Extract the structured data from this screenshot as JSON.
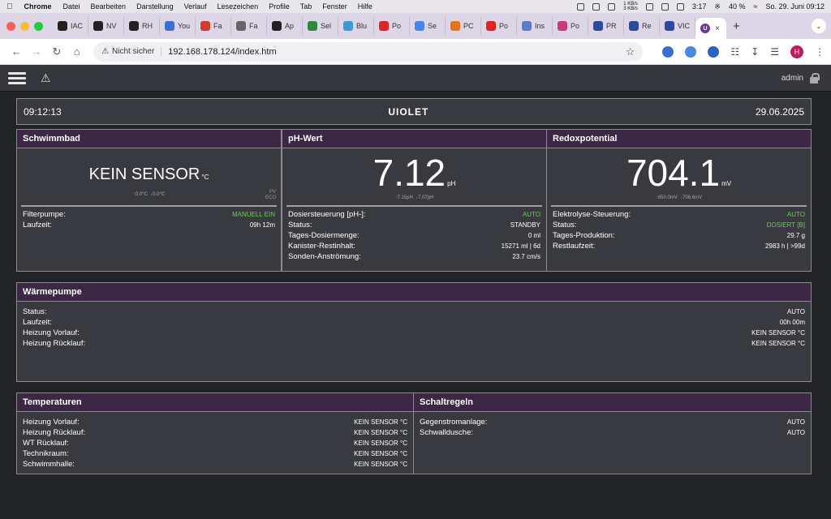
{
  "menubar": {
    "app": "Chrome",
    "items": [
      "Datei",
      "Bearbeiten",
      "Darstellung",
      "Verlauf",
      "Lesezeichen",
      "Profile",
      "Tab",
      "Fenster",
      "Hilfe"
    ],
    "net_up": "1 KB/s",
    "net_down": "3 KB/s",
    "time_small": "3:17",
    "battery": "40 %",
    "datetime": "So. 29. Juni  09:12"
  },
  "tabs": [
    {
      "label": "IAC",
      "color": "#222"
    },
    {
      "label": "NV",
      "color": "#222"
    },
    {
      "label": "RH",
      "color": "#222"
    },
    {
      "label": "You",
      "color": "#3b6fd6"
    },
    {
      "label": "Fa",
      "color": "#d23c2a"
    },
    {
      "label": "Fa",
      "color": "#666"
    },
    {
      "label": "Ap",
      "color": "#222"
    },
    {
      "label": "Sel",
      "color": "#2c8a3a"
    },
    {
      "label": "Blu",
      "color": "#3a9bd6"
    },
    {
      "label": "Po",
      "color": "#e02424"
    },
    {
      "label": "Se",
      "color": "#4285f4"
    },
    {
      "label": "PC",
      "color": "#e8721c"
    },
    {
      "label": "Po",
      "color": "#e02424"
    },
    {
      "label": "Ins",
      "color": "#5a7bc9"
    },
    {
      "label": "Po",
      "color": "#c93b7a"
    },
    {
      "label": "PR",
      "color": "#2b4aa0"
    },
    {
      "label": "Re",
      "color": "#2b4aa0"
    },
    {
      "label": "VIC",
      "color": "#2b4aa0"
    }
  ],
  "active_tab": {
    "close": "×"
  },
  "new_tab": "+",
  "tab_menu": "⌄",
  "address": {
    "security": "Nicht sicher",
    "url": "192.168.178.124/index.htm"
  },
  "profile_initial": "H",
  "app": {
    "user": "admin"
  },
  "clock": {
    "time": "09:12:13",
    "brand": "UIOLET",
    "date": "29.06.2025"
  },
  "pool": {
    "title": "Schwimmbad",
    "value": "KEIN SENSOR",
    "unit": "°C",
    "max": "0.0°C",
    "min": "0.0°C",
    "tag1": "PV",
    "tag2": "ECO",
    "rows": [
      {
        "label": "Filterpumpe:",
        "value": "MANUELL EIN",
        "green": true
      },
      {
        "label": "Laufzeit:",
        "value": "09h 12m",
        "green": false
      }
    ]
  },
  "ph": {
    "title": "pH-Wert",
    "value": "7.12",
    "unit": "pH",
    "max": "7.15pH",
    "min": "7.07pH",
    "rows": [
      {
        "label": "Dosiersteuerung [pH-]:",
        "value": "AUTO",
        "green": true
      },
      {
        "label": "Status:",
        "value": "STANDBY",
        "green": false
      },
      {
        "label": "Tages-Dosiermenge:",
        "value": "0 ml",
        "green": false
      },
      {
        "label": "Kanister-Restinhalt:",
        "value": "15271 ml | 6d",
        "green": false
      },
      {
        "label": "Sonden-Anströmung:",
        "value": "23.7 cm/s",
        "green": false
      }
    ]
  },
  "redox": {
    "title": "Redoxpotential",
    "value": "704.1",
    "unit": "mV",
    "max": "850.0mV",
    "min": "706.6mV",
    "rows": [
      {
        "label": "Elektrolyse-Steuerung:",
        "value": "AUTO",
        "green": true
      },
      {
        "label": "Status:",
        "value": "DOSIERT [B]",
        "green": true
      },
      {
        "label": "Tages-Produktion:",
        "value": "29.7 g",
        "green": false
      },
      {
        "label": "Restlaufzeit:",
        "value": "2983 h | >99d",
        "green": false
      }
    ]
  },
  "heatpump": {
    "title": "Wärmepumpe",
    "rows": [
      {
        "label": "Status:",
        "value": "AUTO"
      },
      {
        "label": "Laufzeit:",
        "value": "00h 00m"
      },
      {
        "label": "Heizung Vorlauf:",
        "value": "KEIN SENSOR °C"
      },
      {
        "label": "Heizung Rücklauf:",
        "value": "KEIN SENSOR °C"
      }
    ]
  },
  "temps": {
    "title": "Temperaturen",
    "rows": [
      {
        "label": "Heizung Vorlauf:",
        "value": "KEIN SENSOR °C"
      },
      {
        "label": "Heizung Rücklauf:",
        "value": "KEIN SENSOR °C"
      },
      {
        "label": "WT Rücklauf:",
        "value": "KEIN SENSOR °C"
      },
      {
        "label": "Technikraum:",
        "value": "KEIN SENSOR °C"
      },
      {
        "label": "Schwimmhalle:",
        "value": "KEIN SENSOR °C"
      }
    ]
  },
  "switches": {
    "title": "Schaltregeln",
    "rows": [
      {
        "label": "Gegenstromanlage:",
        "value": "AUTO"
      },
      {
        "label": "Schwalldusche:",
        "value": "AUTO"
      }
    ]
  }
}
